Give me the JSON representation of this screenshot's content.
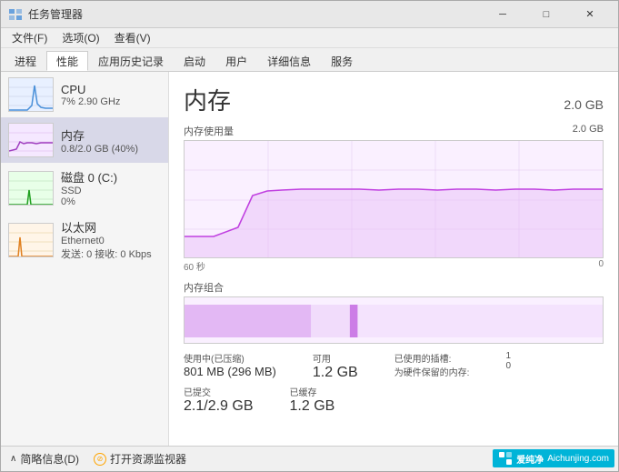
{
  "window": {
    "title": "任务管理器",
    "controls": {
      "minimize": "─",
      "maximize": "□",
      "close": "✕"
    }
  },
  "menu": {
    "items": [
      "文件(F)",
      "选项(O)",
      "查看(V)"
    ]
  },
  "tabs": {
    "items": [
      "进程",
      "性能",
      "应用历史记录",
      "启动",
      "用户",
      "详细信息",
      "服务"
    ],
    "active": 1
  },
  "sidebar": {
    "items": [
      {
        "id": "cpu",
        "title": "CPU",
        "sub1": "7% 2.90 GHz",
        "sub2": "",
        "active": false
      },
      {
        "id": "memory",
        "title": "内存",
        "sub1": "0.8/2.0 GB (40%)",
        "sub2": "",
        "active": true
      },
      {
        "id": "disk",
        "title": "磁盘 0 (C:)",
        "sub1": "SSD",
        "sub2": "0%",
        "active": false
      },
      {
        "id": "network",
        "title": "以太网",
        "sub1": "Ethernet0",
        "sub2": "发送: 0  接收: 0 Kbps",
        "active": false
      }
    ]
  },
  "right": {
    "title": "内存",
    "value": "2.0 GB",
    "chart_label": "内存使用量",
    "chart_max": "2.0 GB",
    "time_left": "60 秒",
    "time_right": "0",
    "combo_label": "内存组合",
    "stats": {
      "in_use_label": "使用中(已压缩)",
      "in_use_value": "801 MB (296 MB)",
      "available_label": "可用",
      "available_value": "1.2 GB",
      "used_slots_label": "已使用的插槽:",
      "used_slots_value": "1",
      "hardware_label": "为硬件保留的内存:",
      "hardware_value": "0",
      "committed_label": "已提交",
      "committed_value": "2.1/2.9 GB",
      "cached_label": "已缓存",
      "cached_value": "1.2 GB"
    }
  },
  "footer": {
    "summary_label": "简略信息(D)",
    "monitor_label": "打开资源监视器"
  },
  "watermark": {
    "text": "爱纯净",
    "sub": "Aichunjing.com"
  }
}
